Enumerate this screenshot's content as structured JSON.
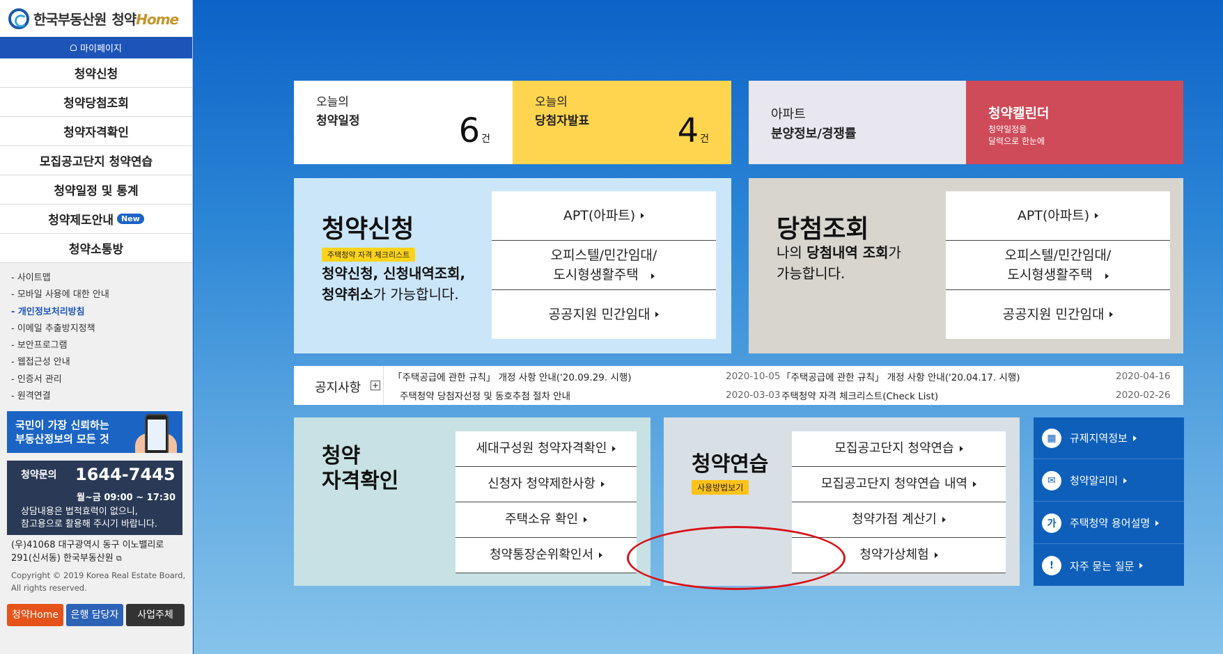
{
  "sidebar": {
    "logo_org": "한국부동산원",
    "logo_brand": "청약",
    "logo_home": "Home",
    "mypage": "마이페이지",
    "nav": [
      {
        "label": "청약신청"
      },
      {
        "label": "청약당첨조회"
      },
      {
        "label": "청약자격확인"
      },
      {
        "label": "모집공고단지 청약연습"
      },
      {
        "label": "청약일정 및 통계"
      },
      {
        "label": "청약제도안내",
        "badge": "New"
      },
      {
        "label": "청약소통방"
      }
    ],
    "links": [
      "- 사이트맵",
      "- 모바일 사용에 대한 안내",
      "- 개인정보처리방침",
      "- 이메일 추출방지정책",
      "- 보안프로그램",
      "- 웹접근성 안내",
      "- 인증서 관리",
      "- 원격연결"
    ],
    "banner_line1": "국민이 가장 신뢰하는",
    "banner_line2": "부동산정보의 모든 것",
    "contact_label": "청약문의",
    "contact_phone": "1644-7445",
    "contact_hours": "월~금 09:00 ~ 17:30",
    "contact_note1": "상담내용은 법적효력이 없으니,",
    "contact_note2": "참고용으로 활용해 주시기 바랍니다.",
    "address1": "(우)41068 대구광역시 동구 이노밸리로",
    "address2": "291(신서동) 한국부동산원",
    "copyright1": "Copyright © 2019 Korea Real Estate Board,",
    "copyright2": "All rights reserved.",
    "buttons": [
      "청약Home",
      "은행 담당자",
      "사업주체"
    ]
  },
  "top": {
    "schedule_l1": "오늘의",
    "schedule_l2": "청약일정",
    "schedule_count": "6",
    "winners_l1": "오늘의",
    "winners_l2": "당첨자발표",
    "winners_count": "4",
    "unit": "건",
    "apt_l1": "아파트",
    "apt_l2": "분양정보/경쟁률",
    "calendar_title": "청약캘린더",
    "calendar_l1": "청약일정을",
    "calendar_l2": "달력으로 한눈에"
  },
  "apply": {
    "title": "청약신청",
    "tag": "주택청약 자격 체크리스트",
    "desc1_bold": "청약신청, 신청내역조회,",
    "desc2_bold": "청약취소",
    "desc2_rest": "가 가능합니다.",
    "menu": [
      "APT(아파트)",
      "오피스텔/민간임대/",
      "도시형생활주택",
      "공공지원 민간임대"
    ]
  },
  "win": {
    "title": "당첨조회",
    "desc1_a": "나의 ",
    "desc1_b": "당첨내역 조회",
    "desc1_c": "가",
    "desc2": "가능합니다.",
    "menu": [
      "APT(아파트)",
      "오피스텔/민간임대/",
      "도시형생활주택",
      "공공지원 민간임대"
    ]
  },
  "notice": {
    "head": "공지사항",
    "plus": "+",
    "items": [
      {
        "title": "「주택공급에 관한 규칙」 개정 사항 안내('20.09.29. 시행)",
        "date": "2020-10-05"
      },
      {
        "title": "「주택공급에 관한 규칙」 개정 사항 안내('20.04.17. 시행)",
        "date": "2020-04-16"
      },
      {
        "title": "주택청약 당첨자선정 및 동호추첨 절차 안내",
        "date": "2020-03-03"
      },
      {
        "title": "주택청약 자격 체크리스트(Check List)",
        "date": "2020-02-26"
      }
    ]
  },
  "qual": {
    "title1": "청약",
    "title2": "자격확인",
    "menu": [
      "세대구성원 청약자격확인",
      "신청자 청약제한사항",
      "주택소유 확인",
      "청약통장순위확인서"
    ]
  },
  "practice": {
    "title": "청약연습",
    "tag": "사용방법보기",
    "menu": [
      "모집공고단지 청약연습",
      "모집공고단지 청약연습 내역",
      "청약가점 계산기",
      "청약가상체험"
    ]
  },
  "quick": [
    {
      "icon": "building-icon",
      "glyph": "▦",
      "label": "규제지역정보"
    },
    {
      "icon": "mail-icon",
      "glyph": "✉",
      "label": "청약알리미"
    },
    {
      "icon": "glossary-icon",
      "glyph": "가",
      "label": "주택청약 용어설명"
    },
    {
      "icon": "faq-icon",
      "glyph": "!",
      "label": "자주 묻는 질문"
    }
  ],
  "colors": {
    "brand_blue": "#1c55b7",
    "yellow": "#ffd54f",
    "calendar_red": "#cf4b59",
    "highlight_red": "#d8121a"
  }
}
